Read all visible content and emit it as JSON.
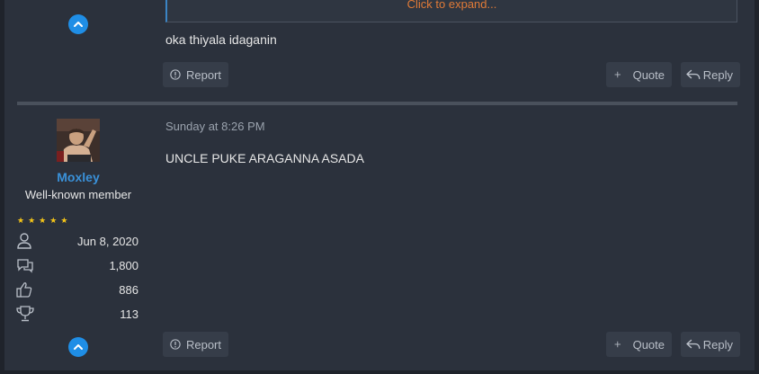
{
  "post1": {
    "quote_expand": "Click to expand...",
    "body": "oka thiyala idaganin",
    "report_label": "Report",
    "quote_label": "Quote",
    "reply_label": "Reply"
  },
  "post2": {
    "username": "Moxley",
    "user_title": "Well-known member",
    "stars": 5,
    "stats": {
      "joined": "Jun 8, 2020",
      "messages": "1,800",
      "reactions": "886",
      "points": "113"
    },
    "timestamp": "Sunday at 8:26 PM",
    "body": "UNCLE PUKE ARAGANNA ASADA",
    "report_label": "Report",
    "quote_label": "Quote",
    "reply_label": "Reply"
  },
  "colors": {
    "accent": "#1f8ee6",
    "username": "#3a91d9",
    "expand_link": "#e07a37",
    "stars": "#f5c518",
    "background": "#2b313c"
  },
  "icons": [
    "scroll-up-icon",
    "report-icon",
    "plus-icon",
    "reply-icon",
    "user-icon",
    "messages-icon",
    "thumbs-up-icon",
    "trophy-icon"
  ]
}
